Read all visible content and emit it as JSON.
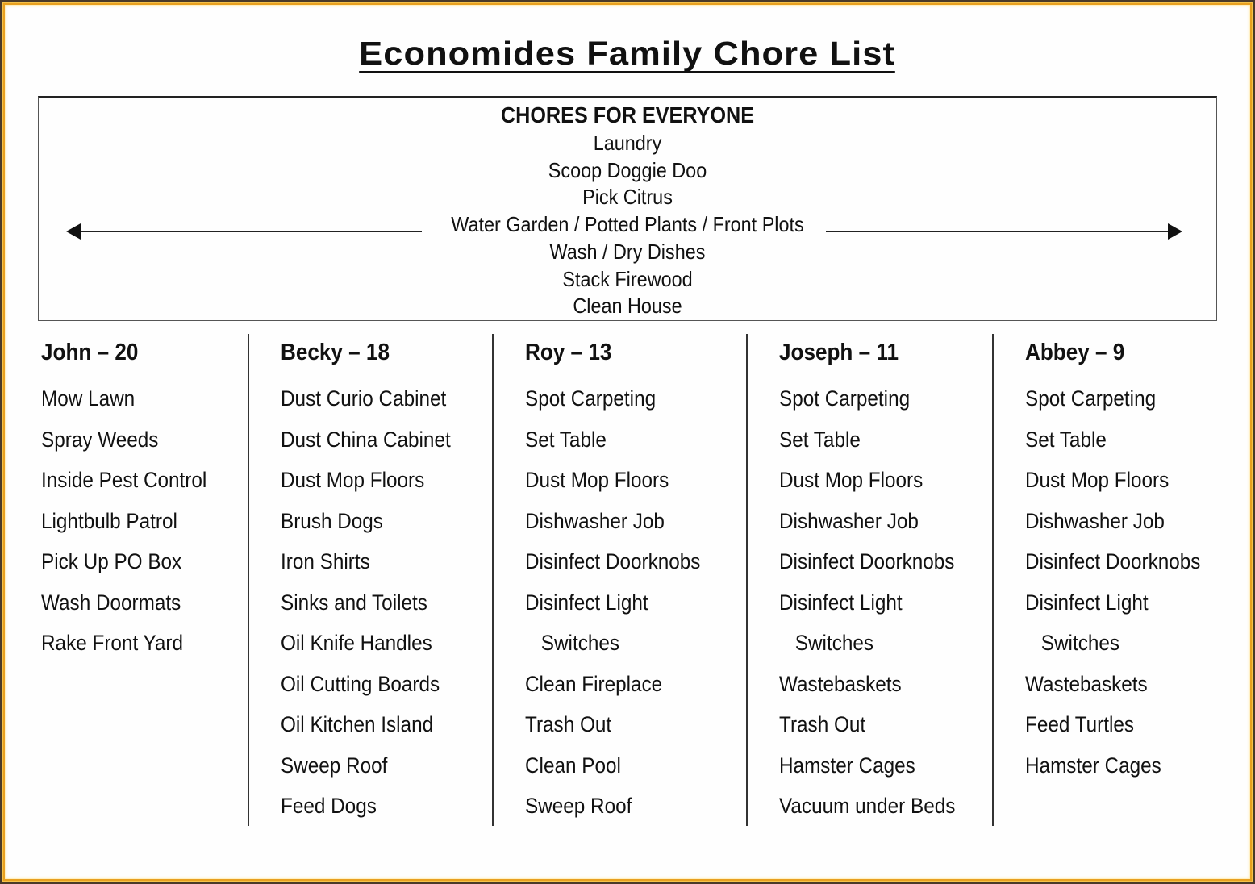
{
  "title": "Economides Family Chore List",
  "colors": {
    "outer_frame": "#4a3a28",
    "gold_border": "#e8a020",
    "page_background": "#fefefe",
    "text": "#111111"
  },
  "everyone": {
    "heading": "CHORES FOR EVERYONE",
    "chores": [
      "Laundry",
      "Scoop Doggie Doo",
      "Pick Citrus",
      "Water Garden / Potted Plants / Front Plots",
      "Wash / Dry Dishes",
      "Stack Firewood",
      "Clean House"
    ],
    "arrow_icons": [
      "arrow-left-icon",
      "arrow-right-icon"
    ]
  },
  "people": [
    {
      "heading": "John – 20",
      "name": "John",
      "age": 20,
      "chores": [
        "Mow Lawn",
        "Spray Weeds",
        "Inside Pest Control",
        "Lightbulb Patrol",
        "Pick Up PO Box",
        "Wash Doormats",
        "Rake Front Yard"
      ]
    },
    {
      "heading": "Becky – 18",
      "name": "Becky",
      "age": 18,
      "chores": [
        "Dust Curio Cabinet",
        "Dust China Cabinet",
        "Dust Mop Floors",
        "Brush Dogs",
        "Iron Shirts",
        "Sinks and Toilets",
        "Oil Knife Handles",
        "Oil Cutting Boards",
        "Oil Kitchen Island",
        "Sweep Roof",
        "Feed Dogs"
      ]
    },
    {
      "heading": "Roy – 13",
      "name": "Roy",
      "age": 13,
      "chores": [
        "Spot Carpeting",
        "Set Table",
        "Dust Mop Floors",
        "Dishwasher Job",
        "Disinfect Doorknobs",
        "Disinfect Light",
        "Switches",
        "Clean Fireplace",
        "Trash Out",
        "Clean Pool",
        "Sweep Roof"
      ]
    },
    {
      "heading": "Joseph – 11",
      "name": "Joseph",
      "age": 11,
      "chores": [
        "Spot Carpeting",
        "Set Table",
        "Dust Mop Floors",
        "Dishwasher Job",
        "Disinfect Doorknobs",
        "Disinfect Light",
        "Switches",
        "Wastebaskets",
        "Trash Out",
        "Hamster Cages",
        "Vacuum under Beds"
      ]
    },
    {
      "heading": "Abbey – 9",
      "name": "Abbey",
      "age": 9,
      "chores": [
        "Spot Carpeting",
        "Set Table",
        "Dust Mop Floors",
        "Dishwasher Job",
        "Disinfect Doorknobs",
        "Disinfect Light",
        "Switches",
        "Wastebaskets",
        "Feed Turtles",
        "Hamster Cages"
      ]
    }
  ]
}
